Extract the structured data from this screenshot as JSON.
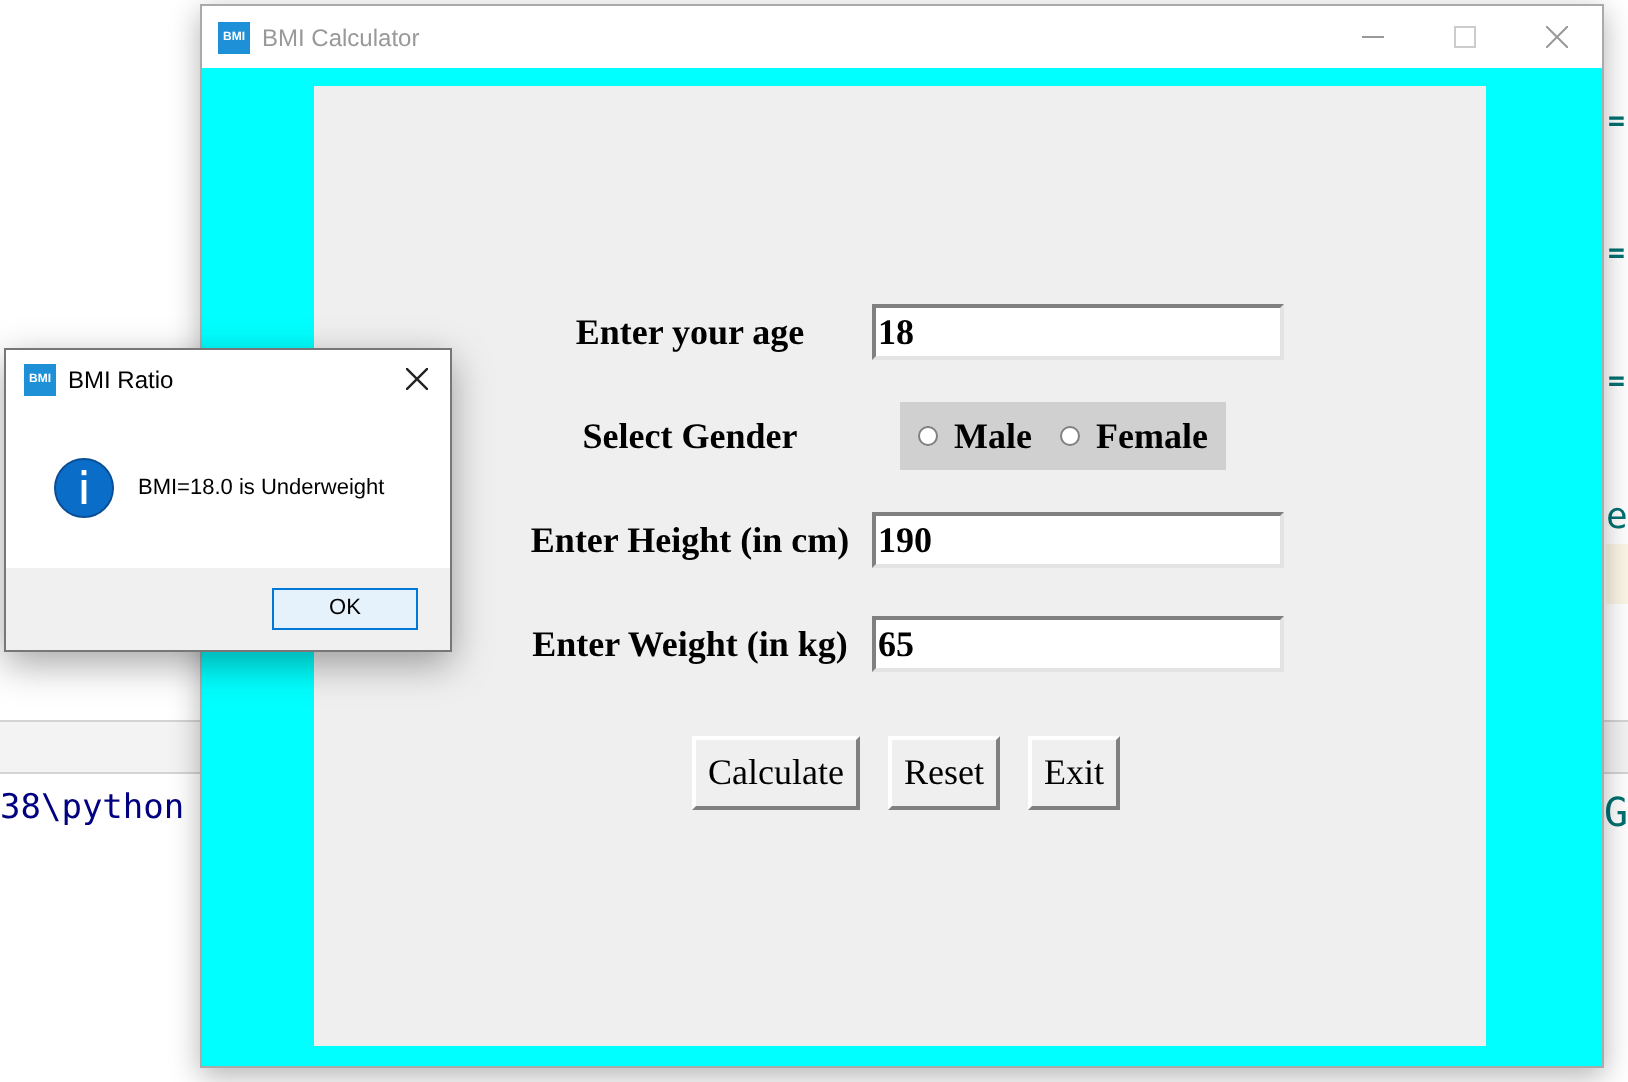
{
  "background_editor": {
    "texts": [
      "38\\python",
      "e",
      "G",
      "=",
      "=",
      "="
    ]
  },
  "main_window": {
    "title": "BMI Calculator",
    "icon_text": "BMI",
    "form": [
      {
        "kind": "entry",
        "label": "Enter your age",
        "value": "18"
      },
      {
        "kind": "radio",
        "label": "Select Gender",
        "options": [
          {
            "label": "Male",
            "selected": false
          },
          {
            "label": "Female",
            "selected": false
          }
        ]
      },
      {
        "kind": "entry",
        "label": "Enter Height (in cm)",
        "value": "190"
      },
      {
        "kind": "entry",
        "label": "Enter Weight (in kg)",
        "value": "65"
      }
    ],
    "buttons": [
      "Calculate",
      "Reset",
      "Exit"
    ]
  },
  "dialog": {
    "title": "BMI Ratio",
    "icon_text": "BMI",
    "message": "BMI=18.0 is Underweight",
    "button": "OK"
  }
}
